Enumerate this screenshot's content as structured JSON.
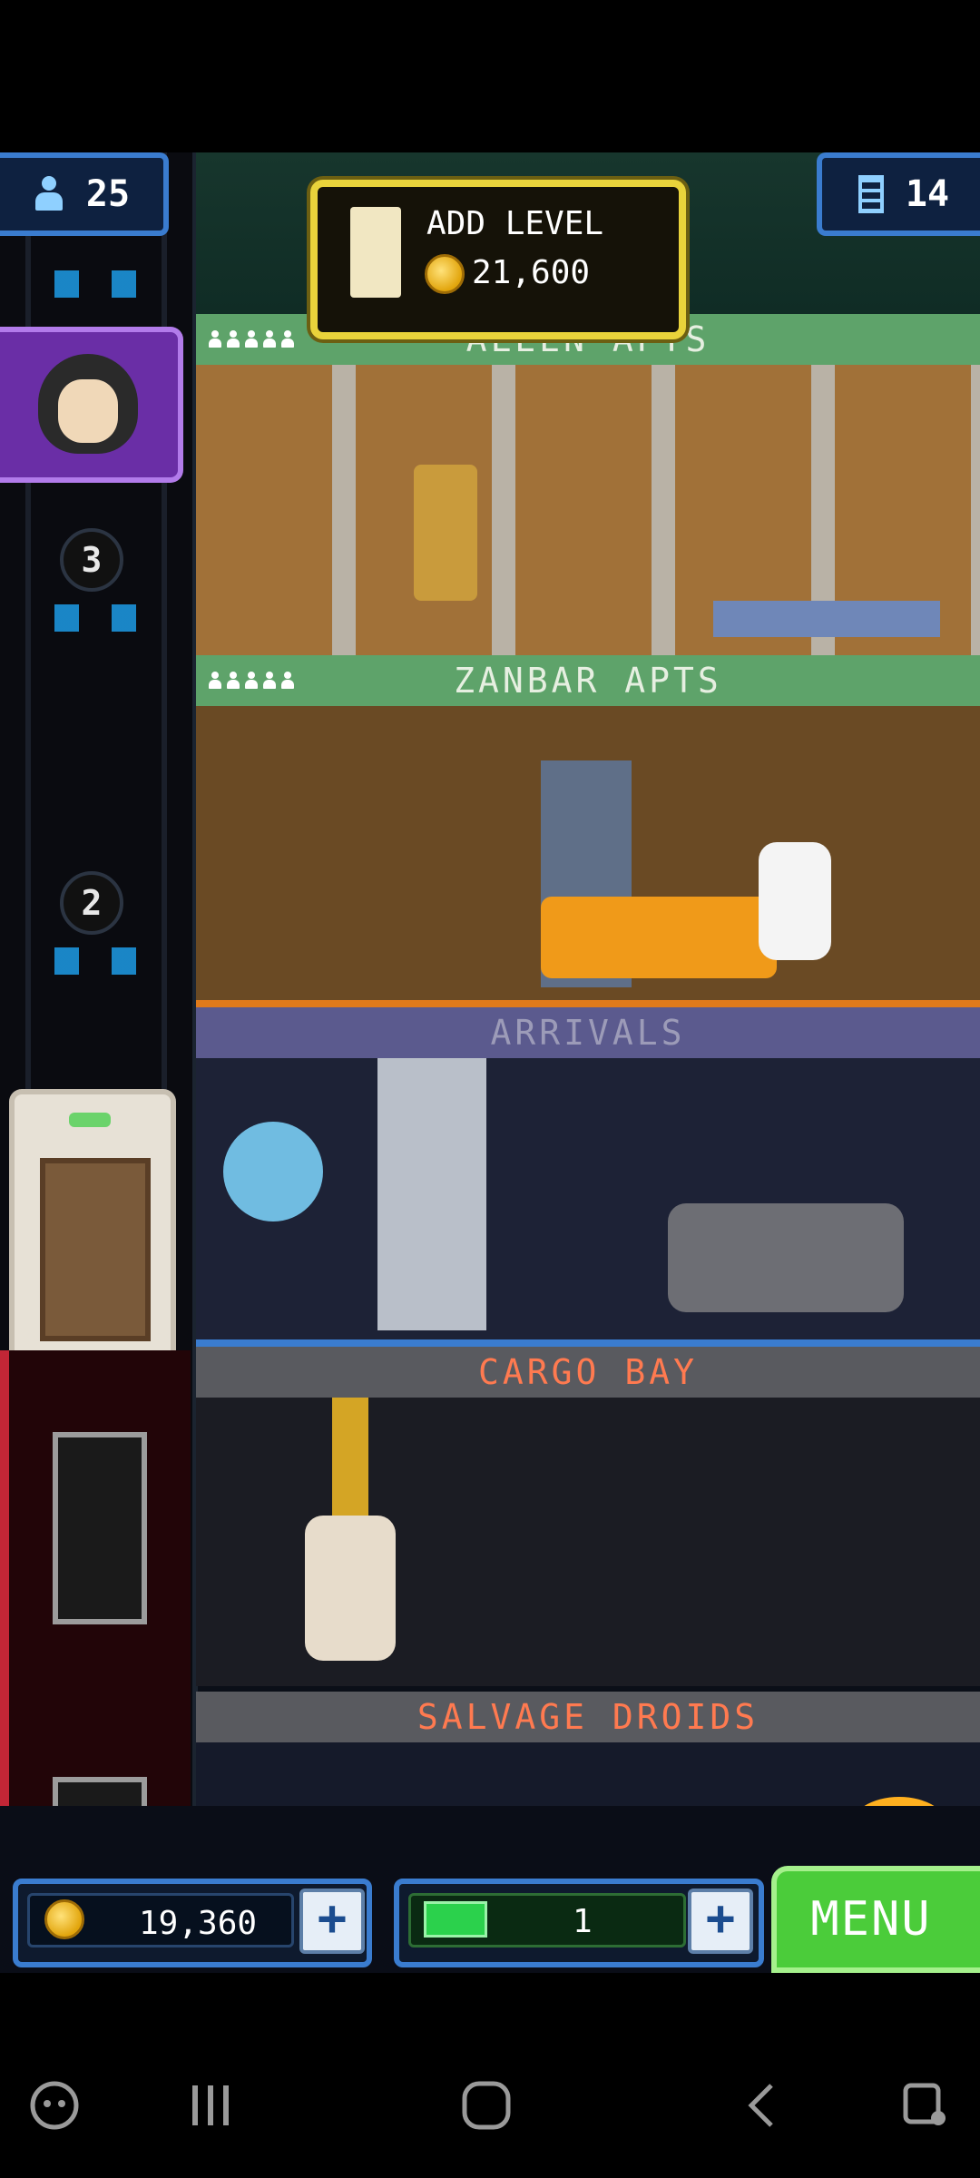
{
  "hud_top": {
    "population": "25",
    "floors": "14"
  },
  "add_level": {
    "title": "ADD LEVEL",
    "cost": "21,600"
  },
  "floors": [
    {
      "name": "ALEEN APTS",
      "label_color": "#e6efe1",
      "band_color": "#5ea36a"
    },
    {
      "name": "ZANBAR APTS",
      "label_color": "#e6efe1",
      "band_color": "#5ea36a"
    },
    {
      "name": "ARRIVALS",
      "label_color": "#9c9bb8",
      "band_color": "#5b5a8e"
    },
    {
      "name": "CARGO BAY",
      "label_color": "#ff7a50",
      "band_color": "#595a5f"
    },
    {
      "name": "SALVAGE DROIDS",
      "label_color": "#ff7a50",
      "band_color": "#595a5f"
    }
  ],
  "elevator_markers": [
    "3",
    "2"
  ],
  "hud_bottom": {
    "coins": "19,360",
    "bux": "1",
    "menu_label": "MENU"
  },
  "icons": {
    "population": "person-icon",
    "floors": "floors-icon",
    "coin": "coin-icon",
    "bux": "bux-icon",
    "plus": "plus-icon"
  },
  "colors": {
    "add_level_border": "#e9d33b",
    "menu_green": "#4bcc3a",
    "hud_blue": "#3a7ccf"
  }
}
